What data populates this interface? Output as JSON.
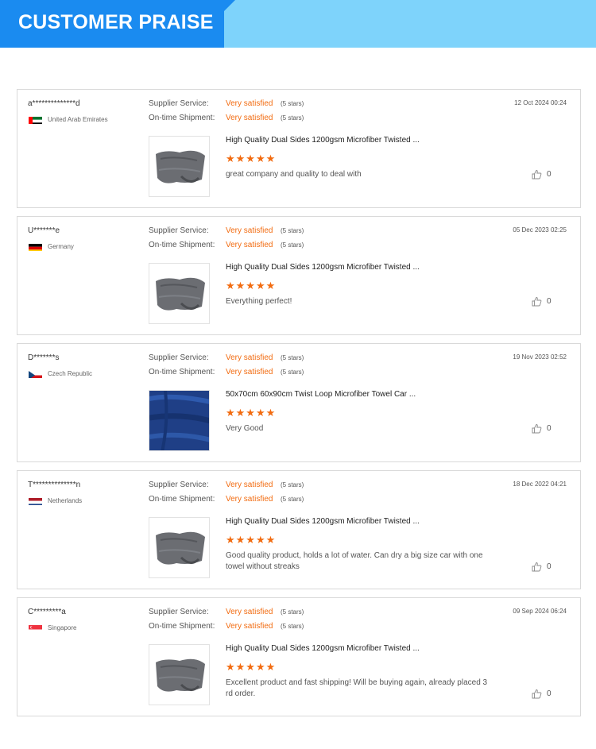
{
  "banner": {
    "title": "CUSTOMER PRAISE"
  },
  "reviews": [
    {
      "reviewer": "a**************d",
      "country": "United Arab Emirates",
      "flag": "uae-flag",
      "supplier_label": "Supplier Service:",
      "supplier_value": "Very satisfied",
      "supplier_stars": "(5 stars)",
      "shipment_label": "On-time Shipment:",
      "shipment_value": "Very satisfied",
      "shipment_stars": "(5 stars)",
      "date": "12 Oct 2024 00:24",
      "product": "High Quality Dual Sides 1200gsm Microfiber Twisted ...",
      "rating": 5,
      "stars": "★★★★★",
      "comment": "great company and quality to deal with",
      "likes": "0",
      "thumb": "gray-towel"
    },
    {
      "reviewer": "U*******e",
      "country": "Germany",
      "flag": "germany-flag",
      "supplier_label": "Supplier Service:",
      "supplier_value": "Very satisfied",
      "supplier_stars": "(5 stars)",
      "shipment_label": "On-time Shipment:",
      "shipment_value": "Very satisfied",
      "shipment_stars": "(5 stars)",
      "date": "05 Dec 2023 02:25",
      "product": "High Quality Dual Sides 1200gsm Microfiber Twisted ...",
      "rating": 5,
      "stars": "★★★★★",
      "comment": "Everything perfect!",
      "likes": "0",
      "thumb": "gray-towel"
    },
    {
      "reviewer": "D*******s",
      "country": "Czech Republic",
      "flag": "czech-flag",
      "supplier_label": "Supplier Service:",
      "supplier_value": "Very satisfied",
      "supplier_stars": "(5 stars)",
      "shipment_label": "On-time Shipment:",
      "shipment_value": "Very satisfied",
      "shipment_stars": "(5 stars)",
      "date": "19 Nov 2023 02:52",
      "product": "50x70cm 60x90cm Twist Loop Microfiber Towel Car ...",
      "rating": 5,
      "stars": "★★★★★",
      "comment": "Very Good",
      "likes": "0",
      "thumb": "blue-towel"
    },
    {
      "reviewer": "T**************n",
      "country": "Netherlands",
      "flag": "netherlands-flag",
      "supplier_label": "Supplier Service:",
      "supplier_value": "Very satisfied",
      "supplier_stars": "(5 stars)",
      "shipment_label": "On-time Shipment:",
      "shipment_value": "Very satisfied",
      "shipment_stars": "(5 stars)",
      "date": "18 Dec 2022 04:21",
      "product": "High Quality Dual Sides 1200gsm Microfiber Twisted ...",
      "rating": 5,
      "stars": "★★★★★",
      "comment": "Good quality product, holds a lot of water. Can dry a big size car with one towel without streaks",
      "likes": "0",
      "thumb": "gray-towel"
    },
    {
      "reviewer": "C*********a",
      "country": "Singapore",
      "flag": "singapore-flag",
      "supplier_label": "Supplier Service:",
      "supplier_value": "Very satisfied",
      "supplier_stars": "(5 stars)",
      "shipment_label": "On-time Shipment:",
      "shipment_value": "Very satisfied",
      "shipment_stars": "(5 stars)",
      "date": "09 Sep 2024 06:24",
      "product": "High Quality Dual Sides 1200gsm Microfiber Twisted ...",
      "rating": 5,
      "stars": "★★★★★",
      "comment": "Excellent product and fast shipping! Will be buying again, already placed 3 rd order.",
      "likes": "0",
      "thumb": "gray-towel"
    }
  ],
  "colors": {
    "banner_tab": "#1a8bf0",
    "banner_bg": "#7ed3fb",
    "accent": "#f26b10"
  }
}
